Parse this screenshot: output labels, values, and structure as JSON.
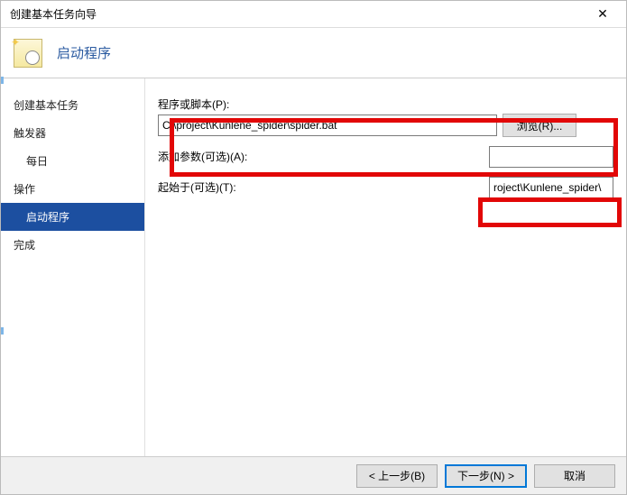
{
  "window": {
    "title": "创建基本任务向导",
    "close": "✕"
  },
  "header": {
    "heading": "启动程序"
  },
  "sidebar": {
    "items": [
      {
        "label": "创建基本任务",
        "indent": "top"
      },
      {
        "label": "触发器",
        "indent": "top"
      },
      {
        "label": "每日",
        "indent": "sub"
      },
      {
        "label": "操作",
        "indent": "top"
      },
      {
        "label": "启动程序",
        "indent": "sub",
        "active": true
      },
      {
        "label": "完成",
        "indent": "top"
      }
    ]
  },
  "form": {
    "script_label": "程序或脚本(P):",
    "script_value": "C:\\project\\Kunlene_spider\\spider.bat",
    "browse_label": "浏览(R)...",
    "args_label": "添加参数(可选)(A):",
    "args_value": "",
    "startin_label": "起始于(可选)(T):",
    "startin_value": "roject\\Kunlene_spider\\"
  },
  "footer": {
    "back": "< 上一步(B)",
    "next": "下一步(N) >",
    "cancel": "取消"
  }
}
